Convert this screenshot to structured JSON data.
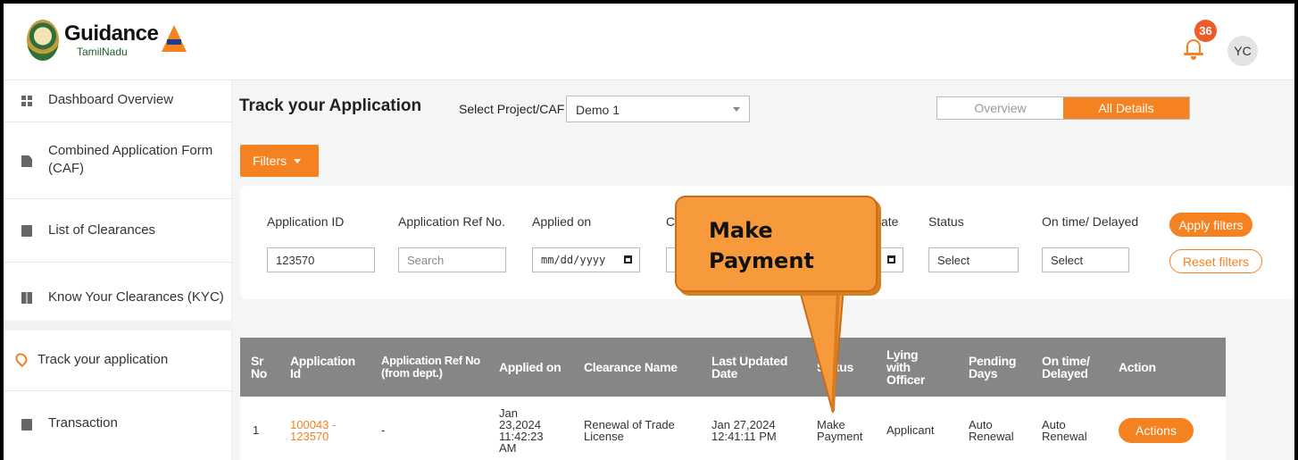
{
  "header": {
    "logo_title": "Guidance",
    "logo_subtitle": "TamilNadu",
    "notification_count": "36",
    "avatar_initials": "YC"
  },
  "sidebar": {
    "items": [
      {
        "label": "Dashboard Overview",
        "icon": "grid-icon",
        "active": false
      },
      {
        "label": "Combined Application Form (CAF)",
        "icon": "document-icon",
        "active": false
      },
      {
        "label": "List of Clearances",
        "icon": "list-icon",
        "active": false
      },
      {
        "label": "Know Your Clearances (KYC)",
        "icon": "book-icon",
        "active": false
      },
      {
        "label": "Track your application",
        "icon": "location-pin-icon",
        "active": true
      },
      {
        "label": "Transaction",
        "icon": "card-icon",
        "active": false
      }
    ]
  },
  "main": {
    "title": "Track your Application",
    "project_label": "Select Project/CAF",
    "project_value": "Demo 1",
    "view_toggle": {
      "overview": "Overview",
      "all_details": "All Details",
      "selected": "All Details"
    },
    "filters_button": "Filters",
    "filters": {
      "application_id_label": "Application ID",
      "application_id_value": "123570",
      "ref_no_label": "Application Ref No.",
      "ref_no_placeholder": "Search",
      "applied_on_label": "Applied on",
      "applied_on_placeholder": "mm/dd/yyyy",
      "clearance_label_partial": "Cl",
      "clearance_input_partial": "S",
      "date_label_partial": "ate",
      "status_label": "Status",
      "status_value": "Select",
      "ontime_label": "On time/ Delayed",
      "ontime_value": "Select",
      "apply_button": "Apply filters",
      "reset_button": "Reset filters"
    },
    "table": {
      "headers": [
        "Sr No",
        "Application Id",
        "Application Ref No (from dept.)",
        "Applied on",
        "Clearance Name",
        "Last Updated Date",
        "Status",
        "Lying with Officer",
        "Pending Days",
        "On time/ Delayed",
        "Action"
      ],
      "rows": [
        {
          "sr": "1",
          "app_id": "100043 - 123570",
          "ref_no": "-",
          "applied_on": "Jan 23,2024 11:42:23 AM",
          "clearance": "Renewal of Trade License",
          "last_updated": "Jan 27,2024 12:41:11 PM",
          "status": "Make Payment",
          "lying_with": "Applicant",
          "pending_days": "Auto Renewal",
          "on_time": "Auto Renewal",
          "action": "Actions"
        }
      ]
    }
  },
  "callout": {
    "text": "Make Payment"
  },
  "colors": {
    "accent": "#f58220",
    "header_gray": "#868686",
    "badge": "#f0592a"
  }
}
